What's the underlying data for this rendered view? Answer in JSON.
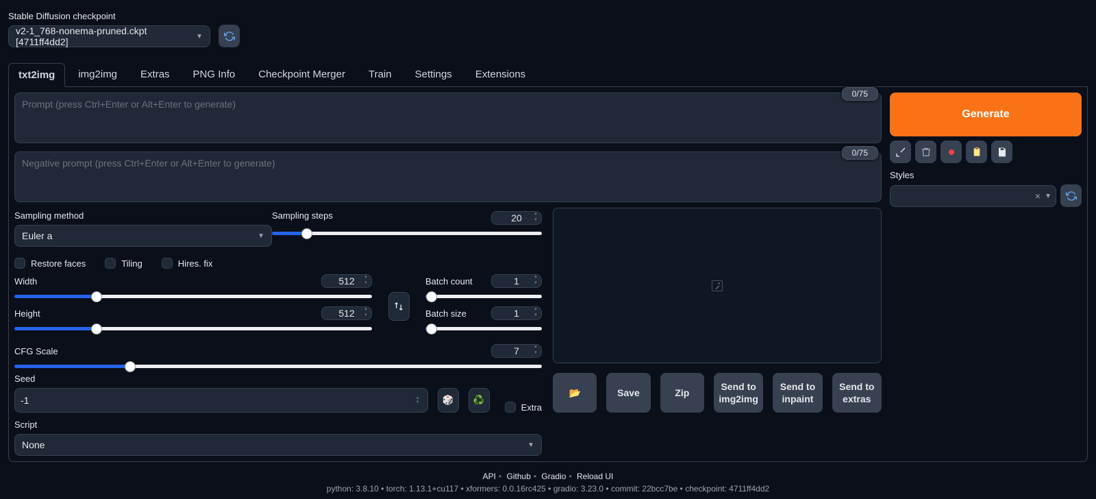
{
  "checkpoint": {
    "label": "Stable Diffusion checkpoint",
    "value": "v2-1_768-nonema-pruned.ckpt [4711ff4dd2]"
  },
  "tabs": [
    "txt2img",
    "img2img",
    "Extras",
    "PNG Info",
    "Checkpoint Merger",
    "Train",
    "Settings",
    "Extensions"
  ],
  "prompt": {
    "placeholder": "Prompt (press Ctrl+Enter or Alt+Enter to generate)",
    "counter": "0/75"
  },
  "negative_prompt": {
    "placeholder": "Negative prompt (press Ctrl+Enter or Alt+Enter to generate)",
    "counter": "0/75"
  },
  "sampling_method": {
    "label": "Sampling method",
    "value": "Euler a"
  },
  "sampling_steps": {
    "label": "Sampling steps",
    "value": "20",
    "fill": "13%"
  },
  "restore_faces": {
    "label": "Restore faces"
  },
  "tiling": {
    "label": "Tiling"
  },
  "hires_fix": {
    "label": "Hires. fix"
  },
  "width": {
    "label": "Width",
    "value": "512",
    "fill": "23%"
  },
  "height": {
    "label": "Height",
    "value": "512",
    "fill": "23%"
  },
  "batch_count": {
    "label": "Batch count",
    "value": "1",
    "fill": "5%"
  },
  "batch_size": {
    "label": "Batch size",
    "value": "1",
    "fill": "5%"
  },
  "cfg": {
    "label": "CFG Scale",
    "value": "7",
    "fill": "22%"
  },
  "seed": {
    "label": "Seed",
    "value": "-1"
  },
  "extra": {
    "label": "Extra"
  },
  "script": {
    "label": "Script",
    "value": "None"
  },
  "generate": "Generate",
  "styles_label": "Styles",
  "actions": {
    "save": "Save",
    "zip": "Zip",
    "send_img2img": "Send to img2img",
    "send_inpaint": "Send to inpaint",
    "send_extras": "Send to extras"
  },
  "footer": {
    "links": [
      "API",
      "Github",
      "Gradio",
      "Reload UI"
    ],
    "version": "python: 3.8.10  •  torch: 1.13.1+cu117  •  xformers: 0.0.16rc425  •  gradio: 3.23.0  •  commit: 22bcc7be  •  checkpoint: 4711ff4dd2"
  }
}
